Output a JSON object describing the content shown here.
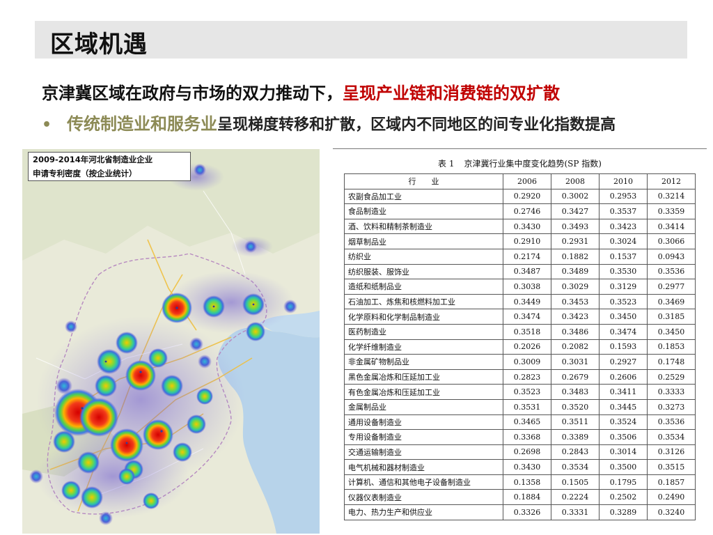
{
  "slide": {
    "title": "区域机遇",
    "headline_main": "京津冀区域在政府与市场的双力推动下，",
    "headline_highlight": "呈现产业链和消费链的双扩散",
    "bullet_symbol": "•",
    "bullet_highlight": "传统制造业和服务业",
    "bullet_rest": "呈现梯度转移和扩散，区域内不同地区的间专业化指数提高"
  },
  "map": {
    "caption_line1": "2009-2014年河北省制造业企业",
    "caption_line2": "申请专利密度（按企业统计）"
  },
  "table": {
    "caption_number": "表 1",
    "caption_title": "京津冀行业集中度变化趋势(SP 指数)",
    "header_industry": "行　　业",
    "years": [
      "2006",
      "2008",
      "2010",
      "2012"
    ],
    "rows": [
      {
        "industry": "农副食品加工业",
        "values": [
          "0.2920",
          "0.3002",
          "0.2953",
          "0.3214"
        ]
      },
      {
        "industry": "食品制造业",
        "values": [
          "0.2746",
          "0.3427",
          "0.3537",
          "0.3359"
        ]
      },
      {
        "industry": "酒、饮料和精制茶制造业",
        "values": [
          "0.3430",
          "0.3493",
          "0.3423",
          "0.3414"
        ]
      },
      {
        "industry": "烟草制品业",
        "values": [
          "0.2910",
          "0.2931",
          "0.3024",
          "0.3066"
        ]
      },
      {
        "industry": "纺织业",
        "values": [
          "0.2174",
          "0.1882",
          "0.1537",
          "0.0943"
        ]
      },
      {
        "industry": "纺织服装、服饰业",
        "values": [
          "0.3487",
          "0.3489",
          "0.3530",
          "0.3536"
        ]
      },
      {
        "industry": "造纸和纸制品业",
        "values": [
          "0.3038",
          "0.3029",
          "0.3129",
          "0.2977"
        ]
      },
      {
        "industry": "石油加工、炼焦和核燃料加工业",
        "values": [
          "0.3449",
          "0.3453",
          "0.3523",
          "0.3469"
        ]
      },
      {
        "industry": "化学原料和化学制品制造业",
        "values": [
          "0.3474",
          "0.3423",
          "0.3450",
          "0.3185"
        ]
      },
      {
        "industry": "医药制造业",
        "values": [
          "0.3518",
          "0.3486",
          "0.3474",
          "0.3450"
        ]
      },
      {
        "industry": "化学纤维制造业",
        "values": [
          "0.2026",
          "0.2082",
          "0.1593",
          "0.1853"
        ]
      },
      {
        "industry": "非金属矿物制品业",
        "values": [
          "0.3009",
          "0.3031",
          "0.2927",
          "0.1748"
        ]
      },
      {
        "industry": "黑色金属冶炼和压延加工业",
        "values": [
          "0.2823",
          "0.2679",
          "0.2606",
          "0.2529"
        ]
      },
      {
        "industry": "有色金属冶炼和压延加工业",
        "values": [
          "0.3523",
          "0.3483",
          "0.3411",
          "0.3333"
        ]
      },
      {
        "industry": "金属制品业",
        "values": [
          "0.3531",
          "0.3520",
          "0.3445",
          "0.3273"
        ]
      },
      {
        "industry": "通用设备制造业",
        "values": [
          "0.3465",
          "0.3511",
          "0.3524",
          "0.3536"
        ]
      },
      {
        "industry": "专用设备制造业",
        "values": [
          "0.3368",
          "0.3389",
          "0.3506",
          "0.3534"
        ]
      },
      {
        "industry": "交通运输制造业",
        "values": [
          "0.2698",
          "0.2843",
          "0.3014",
          "0.3126"
        ]
      },
      {
        "industry": "电气机械和器材制造业",
        "values": [
          "0.3430",
          "0.3534",
          "0.3500",
          "0.3515"
        ]
      },
      {
        "industry": "计算机、通信和其他电子设备制造业",
        "values": [
          "0.1358",
          "0.1505",
          "0.1795",
          "0.1857"
        ]
      },
      {
        "industry": "仪器仪表制造业",
        "values": [
          "0.1884",
          "0.2224",
          "0.2502",
          "0.2490"
        ]
      },
      {
        "industry": "电力、热力生产和供应业",
        "values": [
          "0.3326",
          "0.3331",
          "0.3289",
          "0.3240"
        ]
      }
    ]
  }
}
